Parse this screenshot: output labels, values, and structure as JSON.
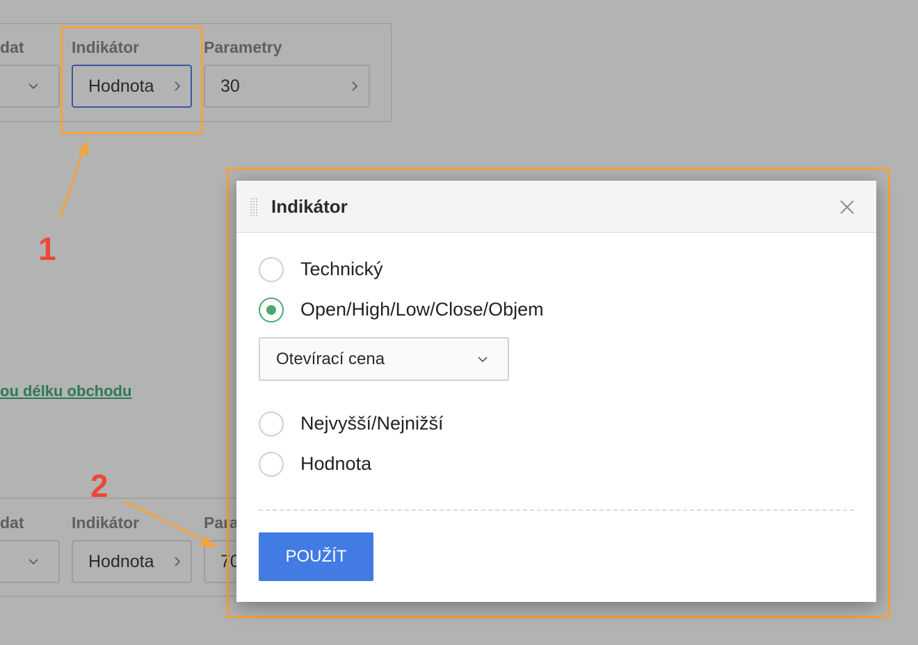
{
  "background": {
    "top_row": {
      "data_label": "dat",
      "indicator_label": "Indikátor",
      "indicator_value": "Hodnota",
      "params_label": "Parametry",
      "params_value": "30"
    },
    "link_text": "ou délku obchodu",
    "bottom_row": {
      "data_label": "dat",
      "indicator_label": "Indikátor",
      "indicator_value": "Hodnota",
      "params_label": "Para",
      "params_value": "70"
    }
  },
  "annotations": {
    "marker_1": "1",
    "marker_2": "2",
    "highlight_color": "#f5a23a",
    "marker_color": "#e8493a"
  },
  "modal": {
    "title": "Indikátor",
    "options": [
      {
        "label": "Technický",
        "checked": false
      },
      {
        "label": "Open/High/Low/Close/Objem",
        "checked": true
      },
      {
        "label": "Nejvyšší/Nejnižší",
        "checked": false
      },
      {
        "label": "Hodnota",
        "checked": false
      }
    ],
    "price_select_value": "Otevírací cena",
    "apply_label": "POUŽÍT",
    "accent_color": "#4ba86a",
    "button_color": "#427be3"
  },
  "icons": {
    "close": "close-icon",
    "drag": "drag-handle-icon",
    "chevron_right": "chevron-right-icon",
    "chevron_down": "chevron-down-icon"
  }
}
